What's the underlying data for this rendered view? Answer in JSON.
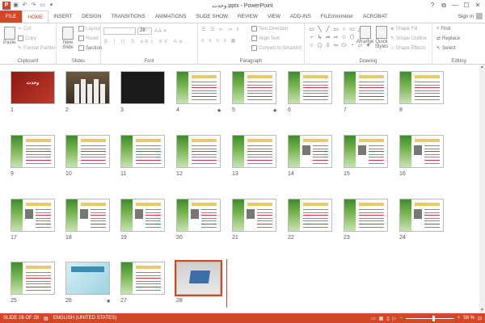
{
  "window": {
    "title": "وحدت.pptx - PowerPoint",
    "app_icon": "P",
    "controls": [
      "?",
      "⧉",
      "—",
      "☐",
      "✕"
    ]
  },
  "tabs": [
    {
      "label": "FILE",
      "kind": "file"
    },
    {
      "label": "HOME",
      "kind": "active"
    },
    {
      "label": "INSERT"
    },
    {
      "label": "DESIGN"
    },
    {
      "label": "TRANSITIONS"
    },
    {
      "label": "ANIMATIONS"
    },
    {
      "label": "SLIDE SHOW"
    },
    {
      "label": "REVIEW"
    },
    {
      "label": "VIEW"
    },
    {
      "label": "ADD-INS"
    },
    {
      "label": "FILEminimizer"
    },
    {
      "label": "ACROBAT"
    }
  ],
  "signin_label": "Sign in",
  "ribbon": {
    "clipboard": {
      "label": "Clipboard",
      "paste": "Paste",
      "cut": "Cut",
      "copy": "Copy",
      "format_painter": "Format Painter"
    },
    "slides": {
      "label": "Slides",
      "new_slide": "New Slide",
      "layout": "Layout",
      "reset": "Reset",
      "section": "Section"
    },
    "font": {
      "label": "Font",
      "size": "28"
    },
    "paragraph": {
      "label": "Paragraph",
      "text_direction": "Text Direction",
      "align_text": "Align Text",
      "convert_smartart": "Convert to SmartArt"
    },
    "drawing": {
      "label": "Drawing",
      "arrange": "Arrange",
      "quick_styles": "Quick Styles",
      "shape_fill": "Shape Fill",
      "shape_outline": "Shape Outline",
      "shape_effects": "Shape Effects"
    },
    "editing": {
      "label": "Editing",
      "find": "Find",
      "replace": "Replace",
      "select": "Select"
    }
  },
  "slides": [
    {
      "n": "1",
      "kind": "maroon",
      "title": "وحدت"
    },
    {
      "n": "2",
      "kind": "crowd"
    },
    {
      "n": "3",
      "kind": "dark"
    },
    {
      "n": "4",
      "kind": "green",
      "star": true
    },
    {
      "n": "5",
      "kind": "green",
      "star": true
    },
    {
      "n": "6",
      "kind": "green"
    },
    {
      "n": "7",
      "kind": "green"
    },
    {
      "n": "8",
      "kind": "green"
    },
    {
      "n": "9",
      "kind": "green"
    },
    {
      "n": "10",
      "kind": "green"
    },
    {
      "n": "11",
      "kind": "green"
    },
    {
      "n": "12",
      "kind": "green"
    },
    {
      "n": "13",
      "kind": "green"
    },
    {
      "n": "14",
      "kind": "photo"
    },
    {
      "n": "15",
      "kind": "photo"
    },
    {
      "n": "16",
      "kind": "photo"
    },
    {
      "n": "17",
      "kind": "photo"
    },
    {
      "n": "18",
      "kind": "photo"
    },
    {
      "n": "19",
      "kind": "photo"
    },
    {
      "n": "20",
      "kind": "photo"
    },
    {
      "n": "21",
      "kind": "photo"
    },
    {
      "n": "22",
      "kind": "green"
    },
    {
      "n": "23",
      "kind": "green"
    },
    {
      "n": "24",
      "kind": "photo"
    },
    {
      "n": "25",
      "kind": "green"
    },
    {
      "n": "26",
      "kind": "teal",
      "star": true
    },
    {
      "n": "27",
      "kind": "green"
    },
    {
      "n": "28",
      "kind": "laptop",
      "selected": true
    }
  ],
  "status": {
    "slide_info": "SLIDE 28 OF 28",
    "language": "ENGLISH (UNITED STATES)",
    "zoom_percent": 58,
    "zoom_label": "58 %"
  }
}
